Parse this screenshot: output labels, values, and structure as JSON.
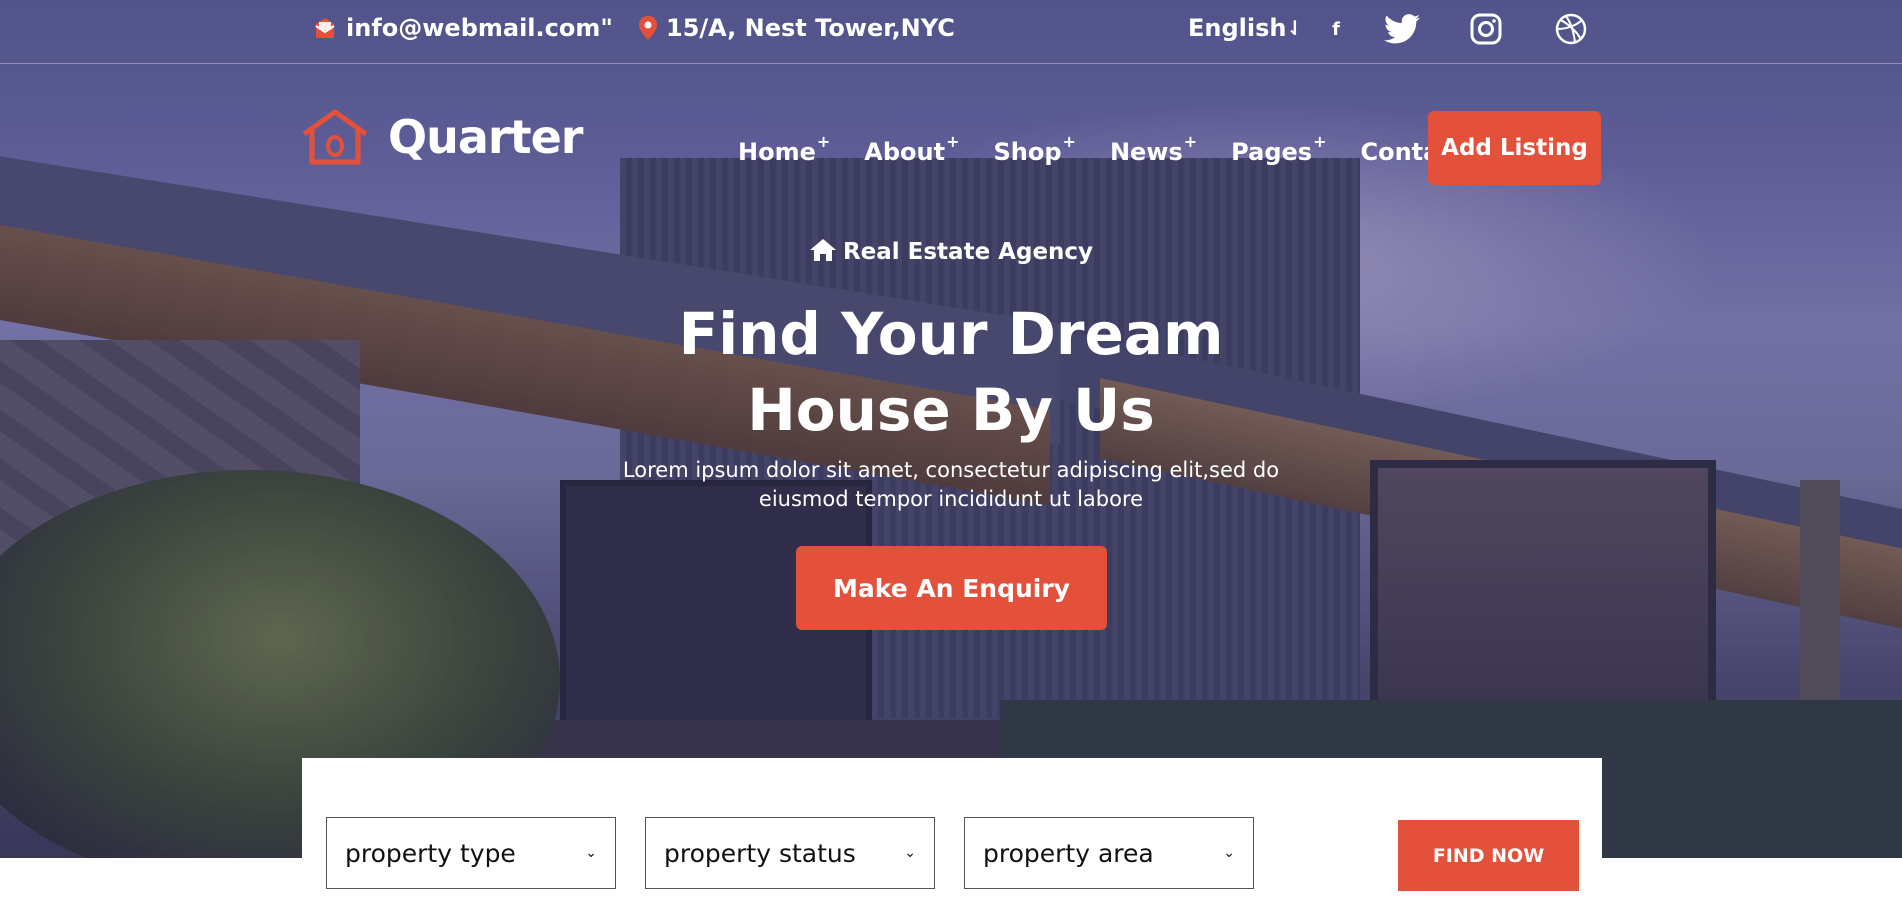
{
  "topbar": {
    "email": "info@webmail.com\"",
    "address": "15/A, Nest Tower,NYC",
    "language": "English",
    "language_arrow": "⇃",
    "social": [
      "facebook-icon",
      "twitter-icon",
      "instagram-icon",
      "dribbble-icon"
    ]
  },
  "brand": {
    "name": "Quarter"
  },
  "nav": {
    "items": [
      {
        "label": "Home",
        "mark": "+"
      },
      {
        "label": "About",
        "mark": "+"
      },
      {
        "label": "Shop",
        "mark": "+"
      },
      {
        "label": "News",
        "mark": "+"
      },
      {
        "label": "Pages",
        "mark": "+"
      },
      {
        "label": "Contact",
        "mark": "+"
      }
    ],
    "cta": "Add Listing"
  },
  "hero": {
    "tagline": "Real Estate Agency",
    "title_line1": "Find Your Dream",
    "title_line2": "House By Us",
    "subtitle_line1": "Lorem ipsum dolor sit amet, consectetur adipiscing elit,sed do",
    "subtitle_line2": "eiusmod tempor incididunt ut labore",
    "button": "Make An Enquiry"
  },
  "search": {
    "type": "property type",
    "status": "property status",
    "area": "property area",
    "button": "FIND NOW"
  },
  "colors": {
    "accent": "#e4513a",
    "overlay": "#5d5f95",
    "text": "#ffffff"
  }
}
